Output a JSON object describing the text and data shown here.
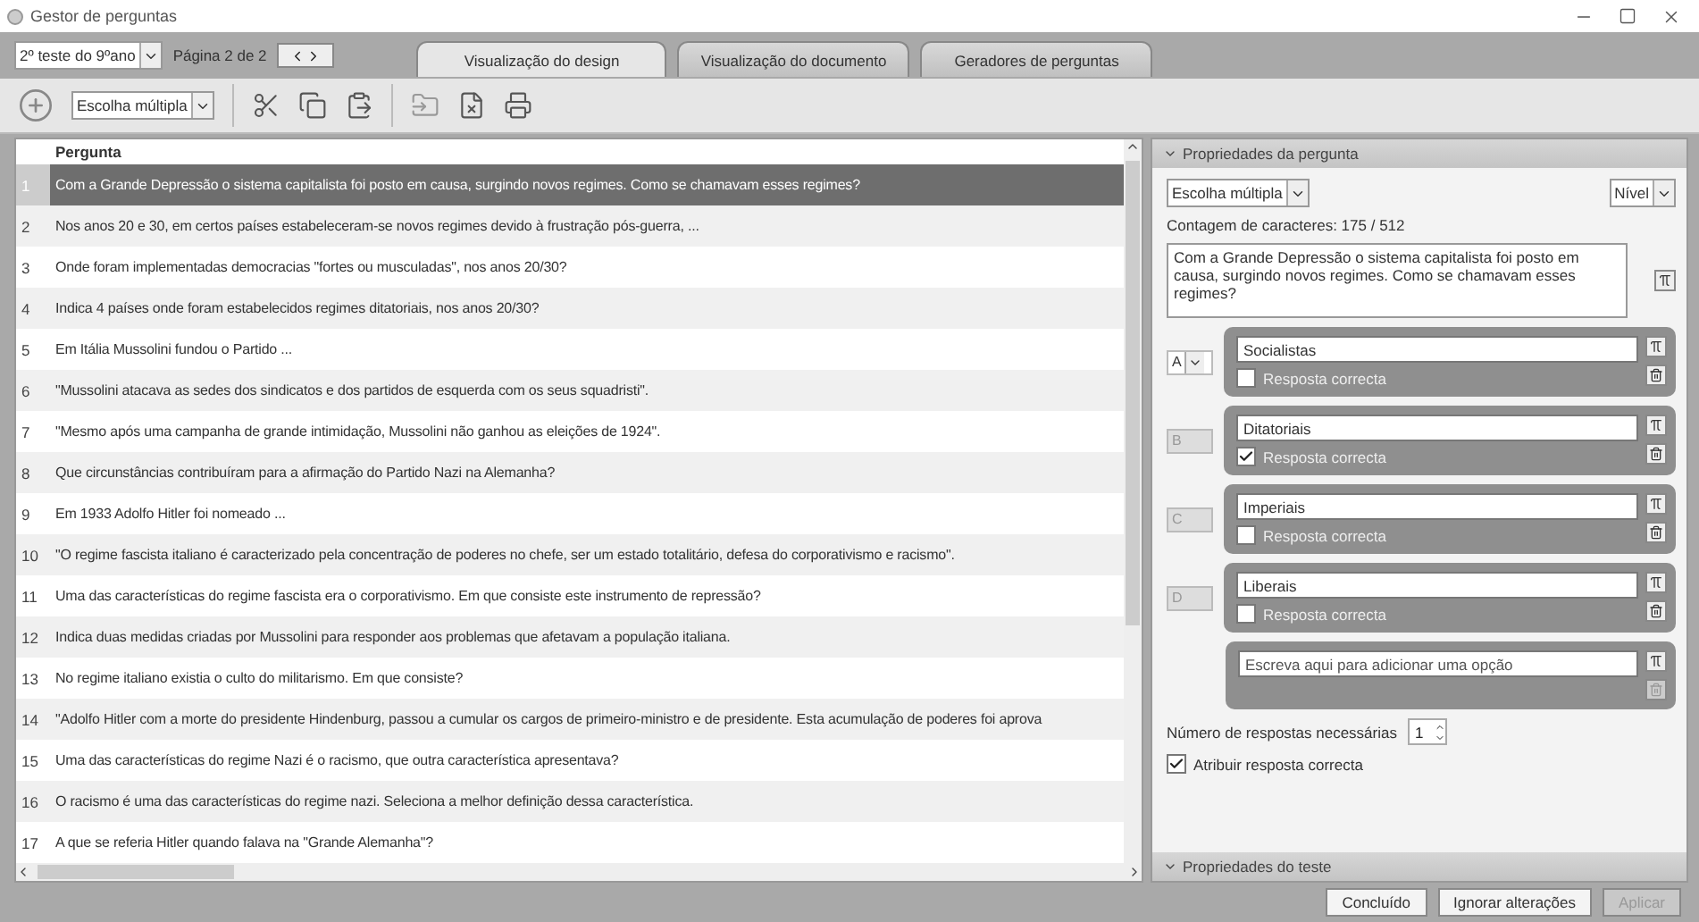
{
  "window": {
    "title": "Gestor de perguntas"
  },
  "top_bar": {
    "test_select": "2º teste do 9ºano",
    "page_label": "Página 2 de 2"
  },
  "tabs": [
    {
      "label": "Visualização do design",
      "selected": true
    },
    {
      "label": "Visualização do documento",
      "selected": false
    },
    {
      "label": "Geradores de perguntas",
      "selected": false
    }
  ],
  "toolbar": {
    "type_select": "Escolha múltipla"
  },
  "table": {
    "column": "Pergunta",
    "rows": [
      {
        "number": "1",
        "text": "Com a Grande Depressão o sistema capitalista foi posto em causa, surgindo novos regimes. Como se chamavam esses regimes?",
        "selected": true
      },
      {
        "number": "2",
        "text": "Nos anos 20 e 30, em certos países estabeleceram-se novos regimes devido à frustração pós-guerra, ...",
        "selected": false
      },
      {
        "number": "3",
        "text": "Onde foram implementadas democracias \"fortes ou musculadas\", nos anos 20/30?",
        "selected": false
      },
      {
        "number": "4",
        "text": "Indica 4 países onde foram estabelecidos regimes ditatoriais, nos anos 20/30?",
        "selected": false
      },
      {
        "number": "5",
        "text": "Em Itália Mussolini fundou o Partido ...",
        "selected": false
      },
      {
        "number": "6",
        "text": "\"Mussolini atacava as sedes dos sindicatos e dos partidos de esquerda com os seus squadristi\".",
        "selected": false
      },
      {
        "number": "7",
        "text": "\"Mesmo após uma campanha de grande intimidação, Mussolini não ganhou as eleições de 1924\".",
        "selected": false
      },
      {
        "number": "8",
        "text": "Que circunstâncias contribuíram para a afirmação do Partido Nazi na Alemanha?",
        "selected": false
      },
      {
        "number": "9",
        "text": "Em 1933 Adolfo Hitler foi nomeado ...",
        "selected": false
      },
      {
        "number": "10",
        "text": "\"O regime fascista italiano é caracterizado pela concentração de poderes no chefe, ser um estado totalitário, defesa do corporativismo e racismo\".",
        "selected": false
      },
      {
        "number": "11",
        "text": "Uma das características do regime fascista era o corporativismo. Em que consiste este instrumento de repressão?",
        "selected": false
      },
      {
        "number": "12",
        "text": "Indica duas medidas criadas por Mussolini para responder aos problemas que afetavam a população italiana.",
        "selected": false
      },
      {
        "number": "13",
        "text": "No regime italiano existia o culto do militarismo. Em que consiste?",
        "selected": false
      },
      {
        "number": "14",
        "text": "\"Adolfo Hitler com a morte do presidente Hindenburg, passou a cumular os cargos de primeiro-ministro e de presidente. Esta acumulação de poderes foi aprova",
        "selected": false
      },
      {
        "number": "15",
        "text": "Uma das características do regime Nazi é o racismo, que outra característica apresentava?",
        "selected": false
      },
      {
        "number": "16",
        "text": "O racismo é uma das características do regime nazi. Seleciona a melhor definição dessa característica.",
        "selected": false
      },
      {
        "number": "17",
        "text": "A que se referia Hitler quando falava na \"Grande Alemanha\"?",
        "selected": false
      }
    ]
  },
  "properties": {
    "title": "Propriedades da pergunta",
    "type_select": "Escolha múltipla",
    "level_select": "Nível",
    "char_count": "Contagem de caracteres: 175 / 512",
    "question_text": "Com a Grande Depressão o sistema capitalista foi posto em causa, surgindo novos regimes. Como se chamavam esses regimes?",
    "options": [
      {
        "kind": "select",
        "letter": "A",
        "text": "Socialistas",
        "correct_label": "Resposta correcta",
        "correct": false
      },
      {
        "kind": "fixed",
        "letter": "B",
        "text": "Ditatoriais",
        "correct_label": "Resposta correcta",
        "correct": true
      },
      {
        "kind": "fixed",
        "letter": "C",
        "text": "Imperiais",
        "correct_label": "Resposta correcta",
        "correct": false
      },
      {
        "kind": "fixed",
        "letter": "D",
        "text": "Liberais",
        "correct_label": "Resposta correcta",
        "correct": false
      }
    ],
    "new_option_placeholder": "Escreva aqui para adicionar uma opção",
    "required_label": "Número de respostas necessárias",
    "required_value": "1",
    "assign_correct": {
      "label": "Atribuir resposta correcta",
      "checked": true
    }
  },
  "test_properties_title": "Propriedades do teste",
  "buttons": [
    {
      "label": "Concluído",
      "disabled": false
    },
    {
      "label": "Ignorar alterações",
      "disabled": false
    },
    {
      "label": "Aplicar",
      "disabled": true
    }
  ]
}
